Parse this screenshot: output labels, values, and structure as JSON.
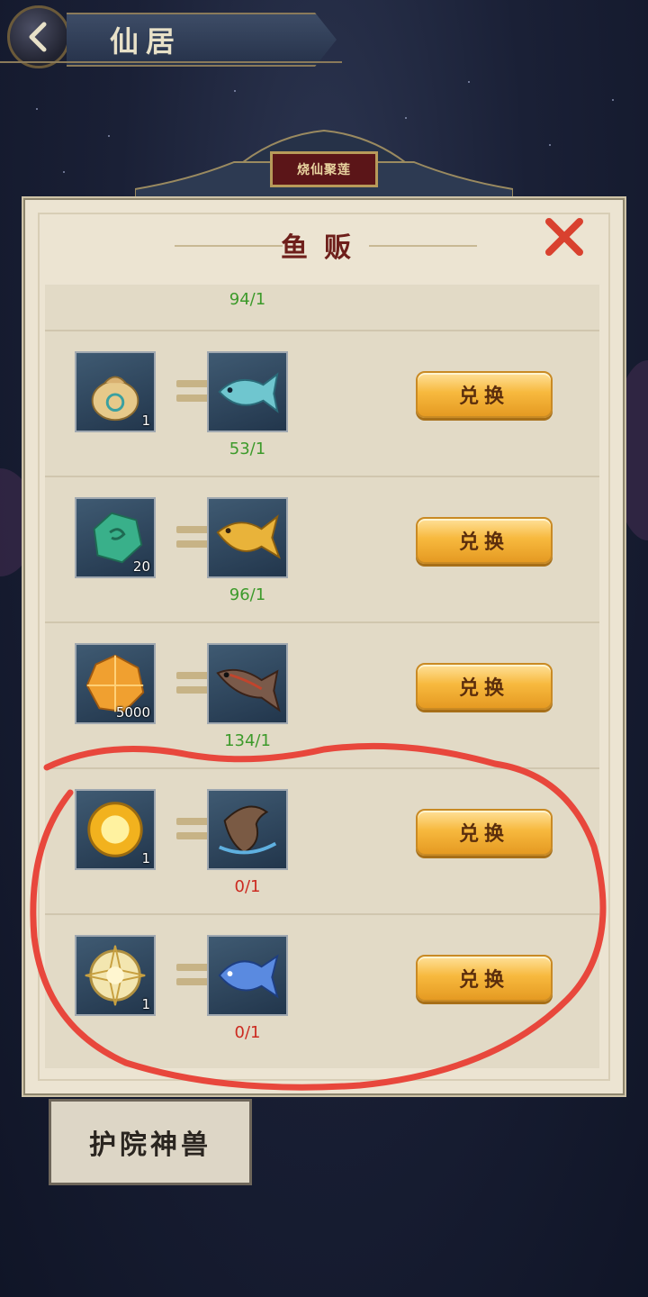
{
  "header": {
    "title": "仙居"
  },
  "pavilion": {
    "plaque_text": "烧仙聚莲"
  },
  "panel": {
    "title": "鱼贩",
    "items": [
      {
        "cost_icon": "partial-item-icon",
        "cost_qty": "",
        "reward_icon": "partial-fish-icon",
        "count": "94/1",
        "count_color": "green",
        "button": ""
      },
      {
        "cost_icon": "coin-pouch-icon",
        "cost_qty": "1",
        "reward_icon": "blue-fish-icon",
        "count": "53/1",
        "count_color": "green",
        "button": "兑换"
      },
      {
        "cost_icon": "jade-stone-icon",
        "cost_qty": "20",
        "reward_icon": "golden-carp-icon",
        "count": "96/1",
        "count_color": "green",
        "button": "兑换"
      },
      {
        "cost_icon": "amber-gem-icon",
        "cost_qty": "5000",
        "reward_icon": "red-carp-icon",
        "count": "134/1",
        "count_color": "green",
        "button": "兑换"
      },
      {
        "cost_icon": "sun-orb-icon",
        "cost_qty": "1",
        "reward_icon": "leaping-fish-icon",
        "count": "0/1",
        "count_color": "red",
        "button": "兑换"
      },
      {
        "cost_icon": "compass-orb-icon",
        "cost_qty": "1",
        "reward_icon": "spirit-fish-icon",
        "count": "0/1",
        "count_color": "red",
        "button": "兑换"
      }
    ]
  },
  "bottom_tab": {
    "label": "护院神兽"
  },
  "colors": {
    "count_green": "#3c9a2a",
    "count_red": "#cc2a20",
    "button_gold": "#f7b93e",
    "annotation_red": "#e8473c"
  }
}
